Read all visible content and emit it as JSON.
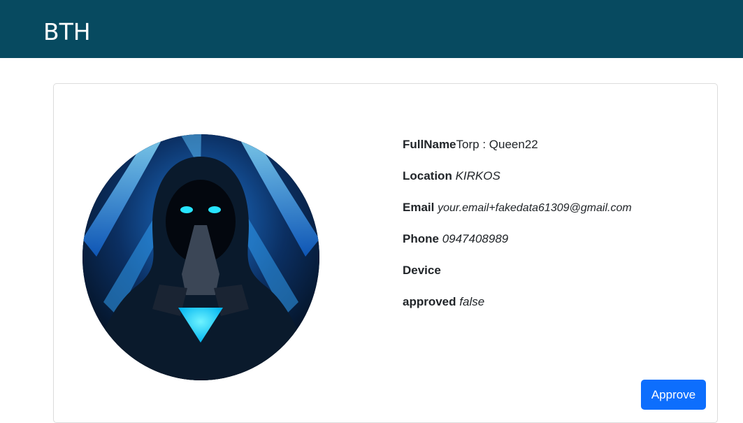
{
  "app": {
    "brand": "BTH"
  },
  "profile": {
    "fullname_label": "FullName",
    "fullname_value": "Torp : Queen22",
    "location_label": "Location",
    "location_value": "KIRKOS",
    "email_label": "Email",
    "email_value": "your.email+fakedata61309@gmail.com",
    "phone_label": "Phone",
    "phone_value": "0947408989",
    "device_label": "Device",
    "device_value": "",
    "approved_label": "approved",
    "approved_value": "false"
  },
  "actions": {
    "approve_label": "Approve"
  },
  "colors": {
    "navbar": "#074a60",
    "primary_button": "#0d6efd",
    "avatar_glow": "#00d8ff"
  },
  "icons": {
    "avatar": "hooded-figure-avatar"
  }
}
